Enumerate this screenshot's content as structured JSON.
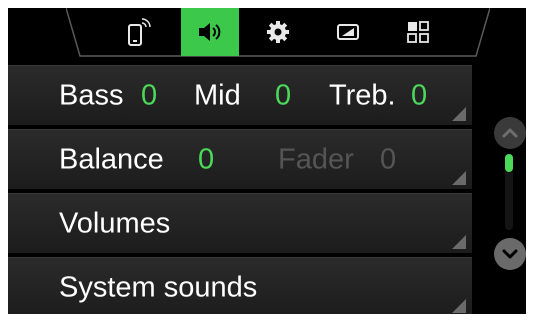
{
  "tabs": [
    {
      "name": "phone-icon",
      "active": false
    },
    {
      "name": "speaker-icon",
      "active": true
    },
    {
      "name": "gear-icon",
      "active": false
    },
    {
      "name": "display-icon",
      "active": false
    },
    {
      "name": "grid-icon",
      "active": false
    }
  ],
  "rows": {
    "tone": {
      "bass_label": "Bass",
      "bass_value": "0",
      "mid_label": "Mid",
      "mid_value": "0",
      "treb_label": "Treb.",
      "treb_value": "0"
    },
    "balance": {
      "balance_label": "Balance",
      "balance_value": "0",
      "fader_label": "Fader",
      "fader_value": "0"
    },
    "volumes": {
      "label": "Volumes"
    },
    "system_sounds": {
      "label": "System sounds"
    }
  },
  "scroll": {
    "position_fraction": 0.0
  },
  "colors": {
    "accent": "#4cd95a",
    "active_tab": "#3cc94b",
    "row_bg": "#262626",
    "disabled_text": "#555555"
  }
}
